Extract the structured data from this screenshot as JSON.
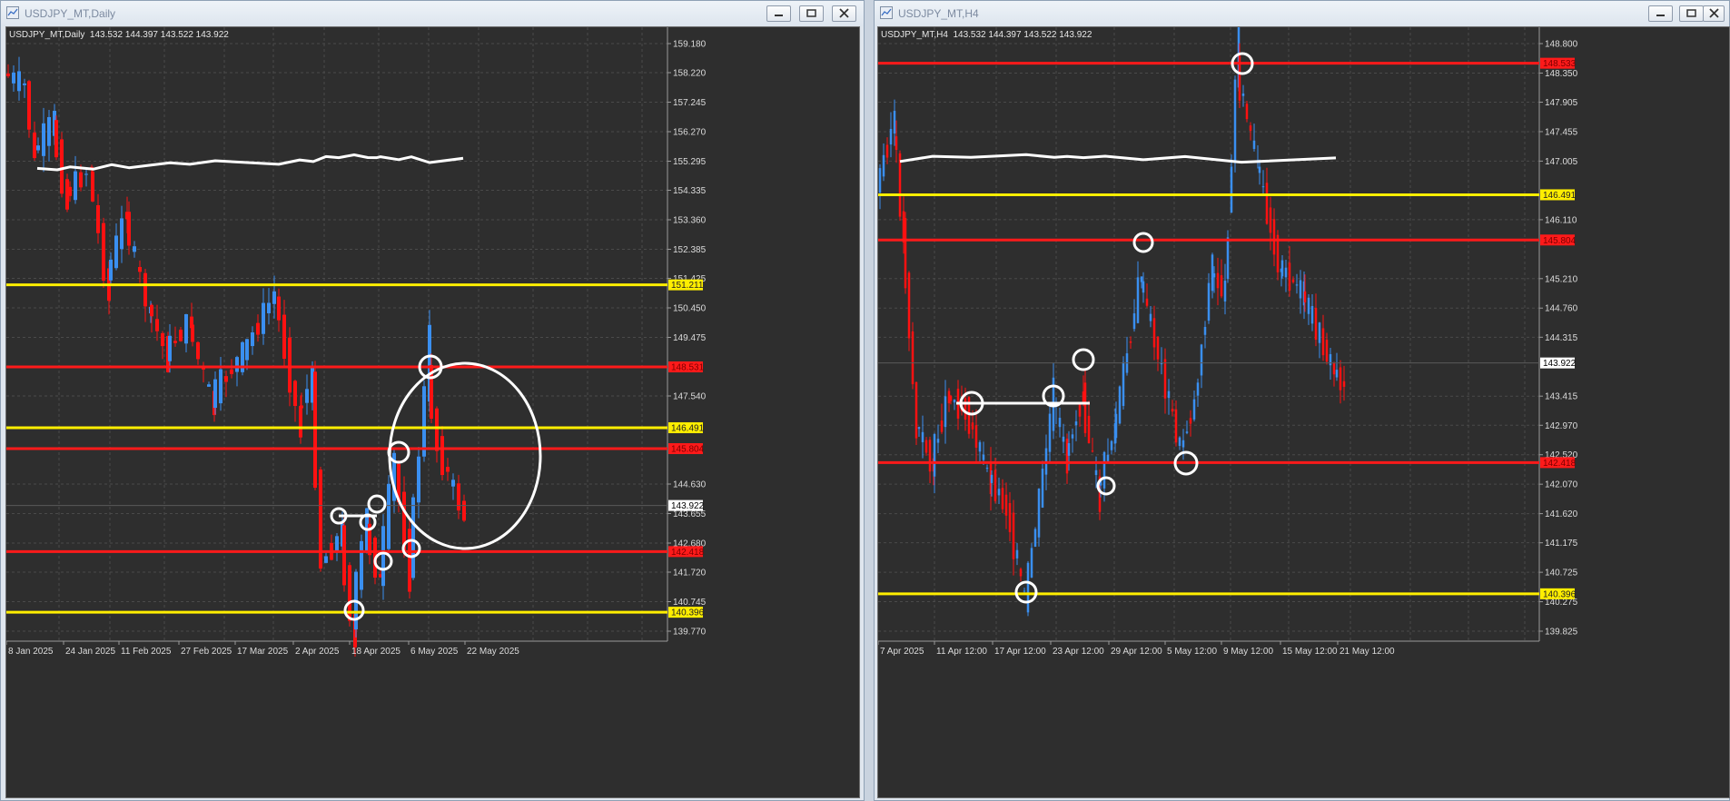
{
  "colors": {
    "red_level": "#ff1a1a",
    "yellow_level": "#ffee00",
    "bull": "#3a8ff0",
    "bear": "#ff1111",
    "background": "#2e2e2e",
    "drawing": "#ffffff"
  },
  "windows": [
    {
      "title": "USDJPY_MT,Daily",
      "info": "USDJPY_MT,Daily  143.532 144.397 143.522 143.922",
      "price_labels": [
        "159.180",
        "158.220",
        "157.245",
        "156.270",
        "155.295",
        "154.335",
        "153.360",
        "152.385",
        "151.425",
        "150.450",
        "149.475",
        "147.540",
        "144.630",
        "143.655",
        "142.680",
        "141.720",
        "140.745",
        "139.770"
      ],
      "date_labels": [
        "8 Jan 2025",
        "24 Jan 2025",
        "11 Feb 2025",
        "27 Feb 2025",
        "17 Mar 2025",
        "2 Apr 2025",
        "18 Apr 2025",
        "6 May 2025",
        "22 May 2025"
      ],
      "levels": [
        {
          "price": 151.211,
          "color": "yellow",
          "label": "151.211"
        },
        {
          "price": 148.5,
          "color": "red",
          "label": "148.531"
        },
        {
          "price": 146.491,
          "color": "yellow",
          "label": "146.491"
        },
        {
          "price": 145.8,
          "color": "red",
          "label": "145.804"
        },
        {
          "price": 142.4,
          "color": "red",
          "label": "142.418"
        },
        {
          "price": 140.396,
          "color": "yellow",
          "label": "140.396"
        }
      ],
      "current_price": "143.922"
    },
    {
      "title": "USDJPY_MT,H4",
      "info": "USDJPY_MT,H4  143.532 144.397 143.522 143.922",
      "price_labels": [
        "148.800",
        "148.350",
        "147.905",
        "147.455",
        "147.005",
        "146.110",
        "145.210",
        "144.760",
        "144.315",
        "143.415",
        "142.970",
        "142.520",
        "142.070",
        "141.620",
        "141.175",
        "140.725",
        "140.275",
        "139.825"
      ],
      "date_labels": [
        "7 Apr 2025",
        "11 Apr 12:00",
        "17 Apr 12:00",
        "23 Apr 12:00",
        "29 Apr 12:00",
        "5 May 12:00",
        "9 May 12:00",
        "15 May 12:00",
        "21 May 12:00"
      ],
      "levels": [
        {
          "price": 148.5,
          "color": "red",
          "label": "148.533"
        },
        {
          "price": 146.491,
          "color": "yellow",
          "label": "146.491"
        },
        {
          "price": 145.8,
          "color": "red",
          "label": "145.804"
        },
        {
          "price": 142.4,
          "color": "red",
          "label": "142.418"
        },
        {
          "price": 140.396,
          "color": "yellow",
          "label": "140.396"
        }
      ],
      "current_price": "143.922"
    }
  ]
}
